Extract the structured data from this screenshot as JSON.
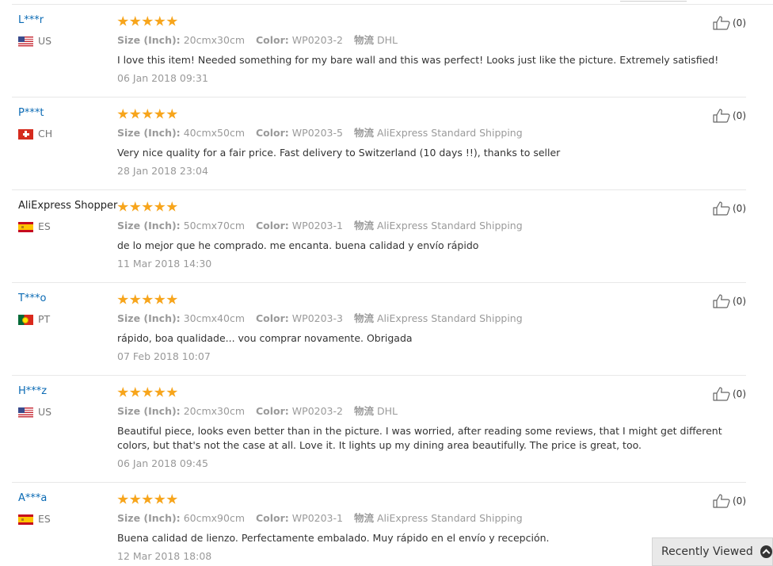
{
  "reviews": [
    {
      "user": "L***r",
      "user_link": true,
      "country": "US",
      "flag": "us",
      "rating": 5,
      "attrs": [
        {
          "name": "Size (Inch):",
          "value": "20cmx30cm"
        },
        {
          "name": "Color:",
          "value": "WP0203-2"
        },
        {
          "name": "物流",
          "value": "DHL"
        }
      ],
      "text": "I love this item! Needed something for my bare wall and this was perfect! Looks just like the picture. Extremely satisfied!",
      "date": "06 Jan 2018 09:31",
      "helpful_count": "(0)"
    },
    {
      "user": "P***t",
      "user_link": true,
      "country": "CH",
      "flag": "ch",
      "rating": 5,
      "attrs": [
        {
          "name": "Size (Inch):",
          "value": "40cmx50cm"
        },
        {
          "name": "Color:",
          "value": "WP0203-5"
        },
        {
          "name": "物流",
          "value": "AliExpress Standard Shipping"
        }
      ],
      "text": "Very nice quality for a fair price. Fast delivery to Switzerland (10 days !!), thanks to seller",
      "date": "28 Jan 2018 23:04",
      "helpful_count": "(0)"
    },
    {
      "user": "AliExpress Shopper",
      "user_link": false,
      "country": "ES",
      "flag": "es",
      "rating": 5,
      "attrs": [
        {
          "name": "Size (Inch):",
          "value": "50cmx70cm"
        },
        {
          "name": "Color:",
          "value": "WP0203-1"
        },
        {
          "name": "物流",
          "value": "AliExpress Standard Shipping"
        }
      ],
      "text": "de lo mejor que he comprado. me encanta. buena calidad y envío rápido",
      "date": "11 Mar 2018 14:30",
      "helpful_count": "(0)"
    },
    {
      "user": "T***o",
      "user_link": true,
      "country": "PT",
      "flag": "pt",
      "rating": 5,
      "attrs": [
        {
          "name": "Size (Inch):",
          "value": "30cmx40cm"
        },
        {
          "name": "Color:",
          "value": "WP0203-3"
        },
        {
          "name": "物流",
          "value": "AliExpress Standard Shipping"
        }
      ],
      "text": "rápido, boa qualidade... vou comprar novamente. Obrigada",
      "date": "07 Feb 2018 10:07",
      "helpful_count": "(0)"
    },
    {
      "user": "H***z",
      "user_link": true,
      "country": "US",
      "flag": "us",
      "rating": 5,
      "attrs": [
        {
          "name": "Size (Inch):",
          "value": "20cmx30cm"
        },
        {
          "name": "Color:",
          "value": "WP0203-2"
        },
        {
          "name": "物流",
          "value": "DHL"
        }
      ],
      "text": "Beautiful piece, looks even better than in the picture. I was worried, after reading some reviews, that I might get different colors, but that's not the case at all. Love it. It lights up my dining area beautifully. The price is great, too.",
      "date": "06 Jan 2018 09:45",
      "helpful_count": "(0)"
    },
    {
      "user": "A***a",
      "user_link": true,
      "country": "ES",
      "flag": "es",
      "rating": 5,
      "attrs": [
        {
          "name": "Size (Inch):",
          "value": "60cmx90cm"
        },
        {
          "name": "Color:",
          "value": "WP0203-1"
        },
        {
          "name": "物流",
          "value": "AliExpress Standard Shipping"
        }
      ],
      "text": "Buena calidad de lienzo. Perfectamente embalado. Muy rápido en el envío y recepción.",
      "date": "12 Mar 2018 18:08",
      "helpful_count": "(0)"
    }
  ],
  "recently_viewed": {
    "label": "Recently Viewed",
    "icon": "chevron-up-circle-icon"
  },
  "colors": {
    "star": "#f7a51c",
    "user_link": "#0a6ab4",
    "muted": "#999999"
  }
}
